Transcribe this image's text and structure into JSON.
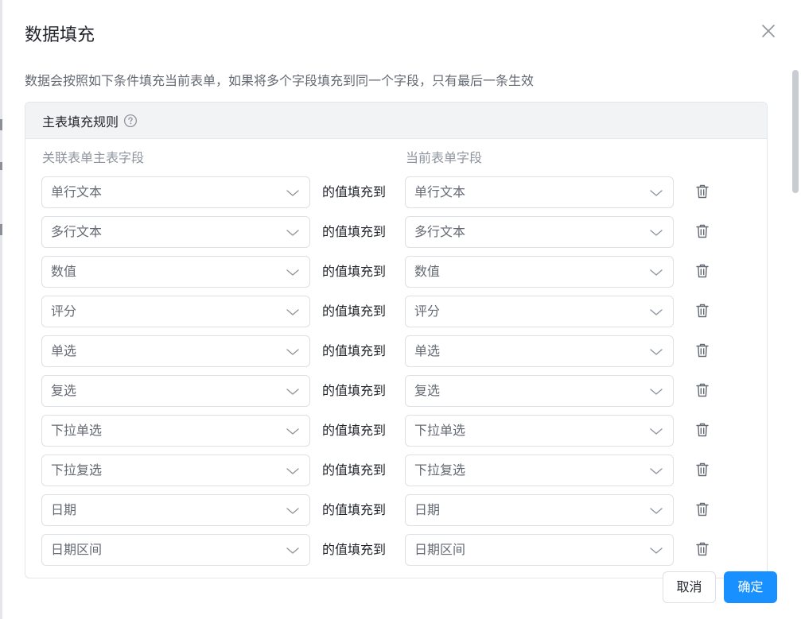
{
  "dialog": {
    "title": "数据填充",
    "description": "数据会按照如下条件填充当前表单，如果将多个字段填充到同一个字段，只有最后一条生效",
    "close_icon": "close-icon"
  },
  "panel": {
    "title": "主表填充规则",
    "help_icon": "question-circle-icon",
    "col_source": "关联表单主表字段",
    "col_target": "当前表单字段",
    "connector": "的值填充到",
    "rows": [
      {
        "source": "单行文本",
        "target": "单行文本"
      },
      {
        "source": "多行文本",
        "target": "多行文本"
      },
      {
        "source": "数值",
        "target": "数值"
      },
      {
        "source": "评分",
        "target": "评分"
      },
      {
        "source": "单选",
        "target": "单选"
      },
      {
        "source": "复选",
        "target": "复选"
      },
      {
        "source": "下拉单选",
        "target": "下拉单选"
      },
      {
        "source": "下拉复选",
        "target": "下拉复选"
      },
      {
        "source": "日期",
        "target": "日期"
      },
      {
        "source": "日期区间",
        "target": "日期区间"
      }
    ]
  },
  "footer": {
    "cancel_label": "取消",
    "ok_label": "确定"
  },
  "colors": {
    "primary": "#1890ff",
    "border": "#dee0e3",
    "header_bg": "#f2f3f5"
  }
}
